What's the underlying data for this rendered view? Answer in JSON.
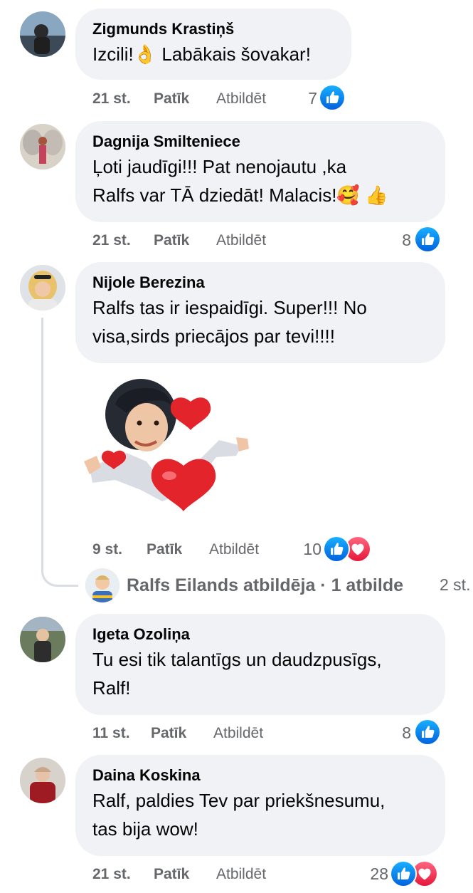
{
  "comments": [
    {
      "author": "Zigmunds Krastiņš",
      "text": "Izcili!👌 Labākais šovakar!",
      "time": "21 st.",
      "like_label": "Patīk",
      "reply_label": "Atbildēt",
      "reaction_count": "7",
      "reactions": [
        "like-icon"
      ]
    },
    {
      "author": "Dagnija Smilteniece",
      "text_lines": [
        "Ļoti jaudīgi!!! Pat nenojautu ,ka",
        "Ralfs var TĀ dziedāt! Malacis!🥰 👍"
      ],
      "time": "21 st.",
      "like_label": "Patīk",
      "reply_label": "Atbildēt",
      "reaction_count": "8",
      "reactions": [
        "like-icon"
      ]
    },
    {
      "author": "Nijole Berezina",
      "text_lines": [
        "Ralfs tas ir iespaidīgi. Super!!! No",
        "visa,sirds priecājos par tevi!!!!"
      ],
      "sticker": "avatar-hearts-sticker",
      "time": "9 st.",
      "like_label": "Patīk",
      "reply_label": "Atbildēt",
      "reaction_count": "10",
      "reactions": [
        "like-icon",
        "love-icon"
      ],
      "replies": {
        "author_text": "Ralfs Eilands atbildēja · 1 atbilde",
        "time": "2 st."
      }
    },
    {
      "author": "Igeta Ozoliņa",
      "text_lines": [
        "Tu esi tik talantīgs un daudzpusīgs,",
        "Ralf!"
      ],
      "time": "11 st.",
      "like_label": "Patīk",
      "reply_label": "Atbildēt",
      "reaction_count": "8",
      "reactions": [
        "like-icon"
      ]
    },
    {
      "author": "Daina Koskina",
      "text_lines": [
        "Ralf, paldies Tev par priekšnesumu,",
        "tas bija wow!"
      ],
      "time": "21 st.",
      "like_label": "Patīk",
      "reply_label": "Atbildēt",
      "reaction_count": "28",
      "reactions": [
        "like-icon",
        "love-icon"
      ]
    }
  ],
  "colors": {
    "like_blue": "#1877f2",
    "love_red": "#f33e58",
    "bubble_bg": "#f0f2f5",
    "meta_gray": "#65676b"
  }
}
